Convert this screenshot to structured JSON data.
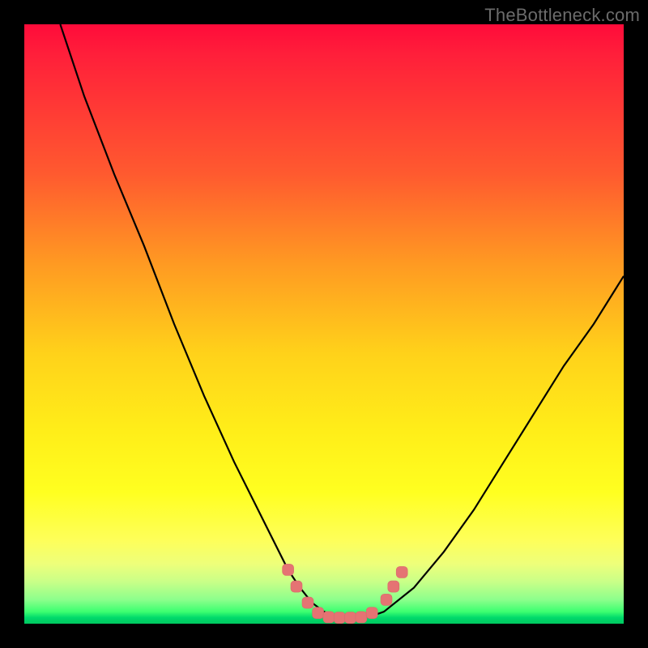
{
  "watermark": {
    "text": "TheBottleneck.com"
  },
  "colors": {
    "frame": "#000000",
    "curve_stroke": "#000000",
    "marker_fill": "#e57373",
    "marker_stroke": "#d96a6a"
  },
  "chart_data": {
    "type": "line",
    "title": "",
    "xlabel": "",
    "ylabel": "",
    "xlim": [
      0,
      100
    ],
    "ylim": [
      0,
      100
    ],
    "grid": false,
    "legend": false,
    "background_gradient": [
      "#ff0b3a",
      "#ffee19",
      "#00c85f"
    ],
    "series": [
      {
        "name": "bottleneck-curve",
        "x": [
          6,
          10,
          15,
          20,
          25,
          30,
          35,
          40,
          44,
          46,
          48,
          50,
          52,
          54,
          56,
          58,
          60,
          65,
          70,
          75,
          80,
          85,
          90,
          95,
          100
        ],
        "y": [
          100,
          88,
          75,
          63,
          50,
          38,
          27,
          17,
          9,
          6,
          3.5,
          2,
          1.3,
          1,
          1,
          1.3,
          2,
          6,
          12,
          19,
          27,
          35,
          43,
          50,
          58
        ]
      }
    ],
    "markers": [
      {
        "x": 44.0,
        "y": 9.0
      },
      {
        "x": 45.4,
        "y": 6.2
      },
      {
        "x": 47.3,
        "y": 3.5
      },
      {
        "x": 49.0,
        "y": 1.8
      },
      {
        "x": 50.8,
        "y": 1.1
      },
      {
        "x": 52.6,
        "y": 1.0
      },
      {
        "x": 54.4,
        "y": 1.0
      },
      {
        "x": 56.2,
        "y": 1.1
      },
      {
        "x": 58.0,
        "y": 1.8
      },
      {
        "x": 60.4,
        "y": 4.0
      },
      {
        "x": 61.6,
        "y": 6.2
      },
      {
        "x": 63.0,
        "y": 8.6
      }
    ],
    "annotations": []
  }
}
